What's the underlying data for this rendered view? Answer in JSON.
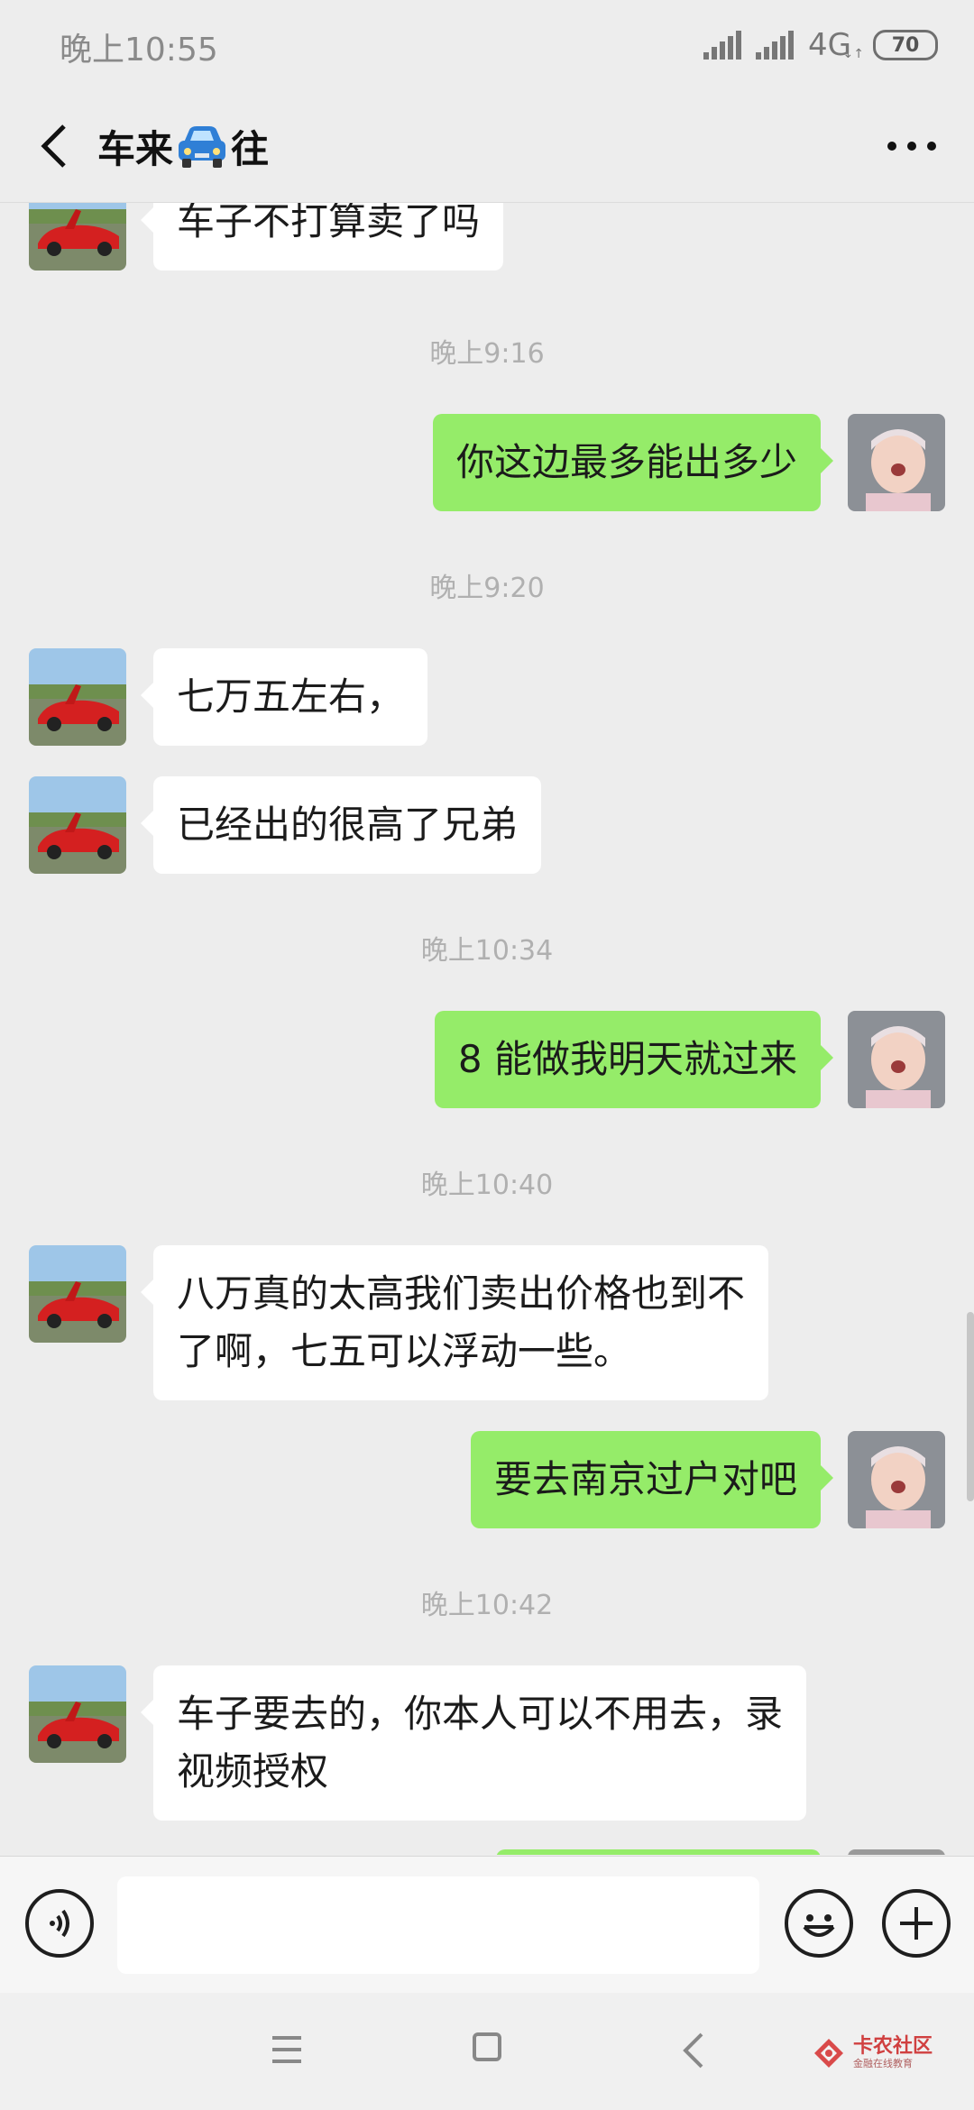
{
  "status_bar": {
    "time": "晚上10:55",
    "network": "4G",
    "battery": "70"
  },
  "header": {
    "title_before": "车来",
    "title_after": "往",
    "title_emoji": "car-emoji-icon"
  },
  "messages": [
    {
      "type": "in",
      "text": "车子不打算卖了吗"
    },
    {
      "type": "time",
      "text": "晚上9:16"
    },
    {
      "type": "out",
      "text": "你这边最多能出多少"
    },
    {
      "type": "time",
      "text": "晚上9:20"
    },
    {
      "type": "in",
      "text": "七万五左右，"
    },
    {
      "type": "in",
      "text": "已经出的很高了兄弟"
    },
    {
      "type": "time",
      "text": "晚上10:34"
    },
    {
      "type": "out",
      "text": "8 能做我明天就过来"
    },
    {
      "type": "time",
      "text": "晚上10:40"
    },
    {
      "type": "in",
      "text": "八万真的太高我们卖出价格也到不\n了啊，七五可以浮动一些。"
    },
    {
      "type": "out",
      "text": "要去南京过户对吧"
    },
    {
      "type": "time",
      "text": "晚上10:42"
    },
    {
      "type": "in",
      "text": "车子要去的，你本人可以不用去，录\n视频授权"
    }
  ],
  "input_bar": {
    "value": "",
    "icons": [
      "voice-icon",
      "emoji-icon",
      "plus-icon"
    ]
  },
  "nav_bar": {
    "icons": [
      "menu-icon",
      "home-icon",
      "back-icon"
    ]
  },
  "watermark": {
    "title": "卡农社区",
    "subtitle": "金融在线教育"
  },
  "colors": {
    "background": "#ededed",
    "outgoing_bubble": "#95ec69",
    "incoming_bubble": "#ffffff"
  }
}
